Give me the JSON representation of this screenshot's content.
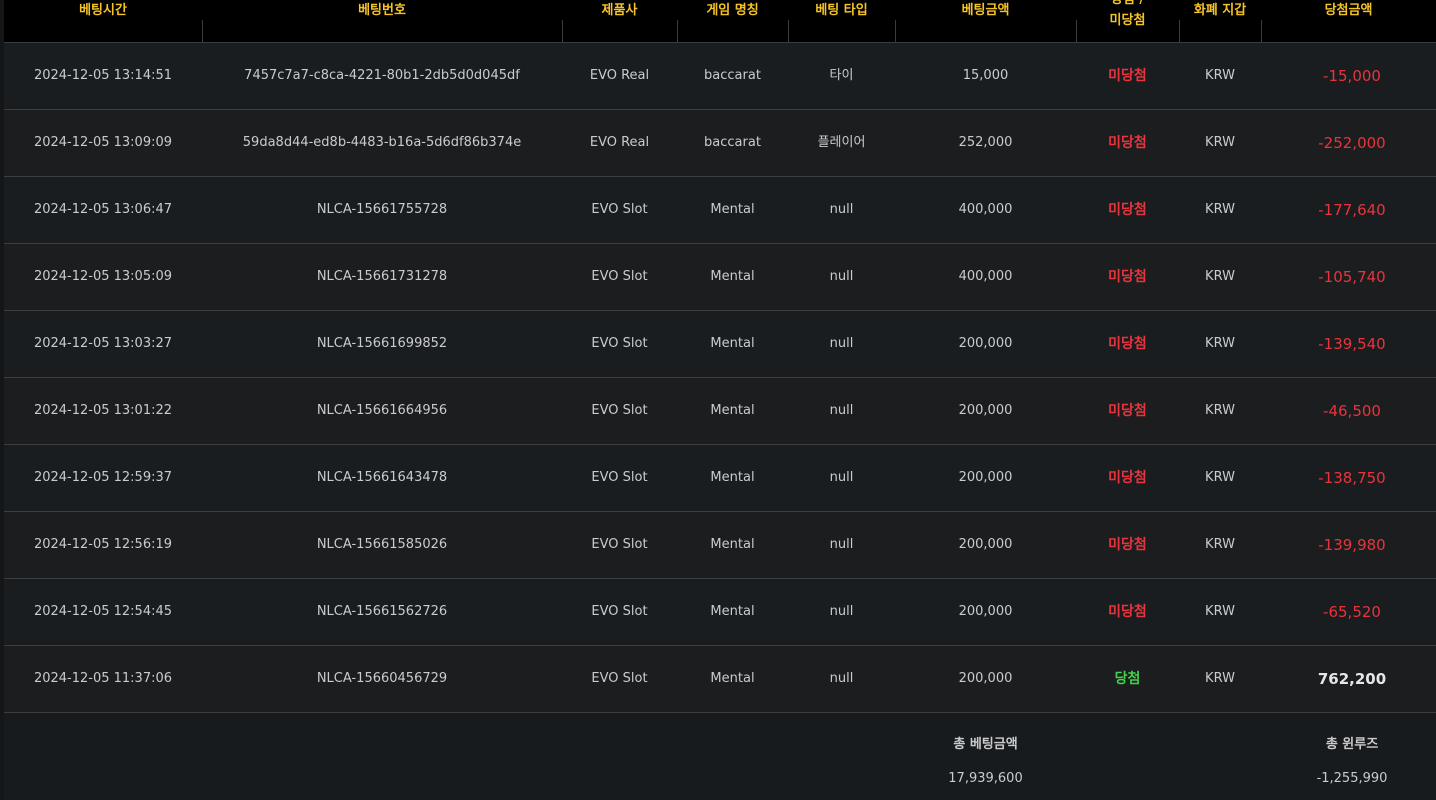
{
  "header": {
    "bet_time": "베팅시간",
    "bet_number": "베팅번호",
    "provider": "제품사",
    "game_name": "게임 명칭",
    "bet_type": "베팅 타입",
    "bet_amount": "베팅금액",
    "result_top": "당첨 /",
    "result_bottom": "미당첨",
    "wallet": "화폐 지갑",
    "win_amount": "당첨금액"
  },
  "rows": [
    {
      "time": "2024-12-05 13:14:51",
      "bet_no": "7457c7a7-c8ca-4221-80b1-2db5d0d045df",
      "provider": "EVO Real",
      "game": "baccarat",
      "type": "타이",
      "amount": "15,000",
      "result": "미당첨",
      "result_kind": "lose",
      "wallet": "KRW",
      "win": "-15,000"
    },
    {
      "time": "2024-12-05 13:09:09",
      "bet_no": "59da8d44-ed8b-4483-b16a-5d6df86b374e",
      "provider": "EVO Real",
      "game": "baccarat",
      "type": "플레이어",
      "amount": "252,000",
      "result": "미당첨",
      "result_kind": "lose",
      "wallet": "KRW",
      "win": "-252,000"
    },
    {
      "time": "2024-12-05 13:06:47",
      "bet_no": "NLCA-15661755728",
      "provider": "EVO Slot",
      "game": "Mental",
      "type": "null",
      "amount": "400,000",
      "result": "미당첨",
      "result_kind": "lose",
      "wallet": "KRW",
      "win": "-177,640"
    },
    {
      "time": "2024-12-05 13:05:09",
      "bet_no": "NLCA-15661731278",
      "provider": "EVO Slot",
      "game": "Mental",
      "type": "null",
      "amount": "400,000",
      "result": "미당첨",
      "result_kind": "lose",
      "wallet": "KRW",
      "win": "-105,740"
    },
    {
      "time": "2024-12-05 13:03:27",
      "bet_no": "NLCA-15661699852",
      "provider": "EVO Slot",
      "game": "Mental",
      "type": "null",
      "amount": "200,000",
      "result": "미당첨",
      "result_kind": "lose",
      "wallet": "KRW",
      "win": "-139,540"
    },
    {
      "time": "2024-12-05 13:01:22",
      "bet_no": "NLCA-15661664956",
      "provider": "EVO Slot",
      "game": "Mental",
      "type": "null",
      "amount": "200,000",
      "result": "미당첨",
      "result_kind": "lose",
      "wallet": "KRW",
      "win": "-46,500"
    },
    {
      "time": "2024-12-05 12:59:37",
      "bet_no": "NLCA-15661643478",
      "provider": "EVO Slot",
      "game": "Mental",
      "type": "null",
      "amount": "200,000",
      "result": "미당첨",
      "result_kind": "lose",
      "wallet": "KRW",
      "win": "-138,750"
    },
    {
      "time": "2024-12-05 12:56:19",
      "bet_no": "NLCA-15661585026",
      "provider": "EVO Slot",
      "game": "Mental",
      "type": "null",
      "amount": "200,000",
      "result": "미당첨",
      "result_kind": "lose",
      "wallet": "KRW",
      "win": "-139,980"
    },
    {
      "time": "2024-12-05 12:54:45",
      "bet_no": "NLCA-15661562726",
      "provider": "EVO Slot",
      "game": "Mental",
      "type": "null",
      "amount": "200,000",
      "result": "미당첨",
      "result_kind": "lose",
      "wallet": "KRW",
      "win": "-65,520"
    },
    {
      "time": "2024-12-05 11:37:06",
      "bet_no": "NLCA-15660456729",
      "provider": "EVO Slot",
      "game": "Mental",
      "type": "null",
      "amount": "200,000",
      "result": "당첨",
      "result_kind": "win",
      "wallet": "KRW",
      "win": "762,200"
    }
  ],
  "footer": {
    "total_bet_label": "총 베팅금액",
    "total_bet_value": "17,939,600",
    "total_winloss_label": "총 윈루즈",
    "total_winloss_value": "-1,255,990"
  },
  "colors": {
    "header_text": "#f6c325",
    "lose": "#e8343c",
    "win": "#3fd24a",
    "body_text": "#c9cbcd"
  }
}
